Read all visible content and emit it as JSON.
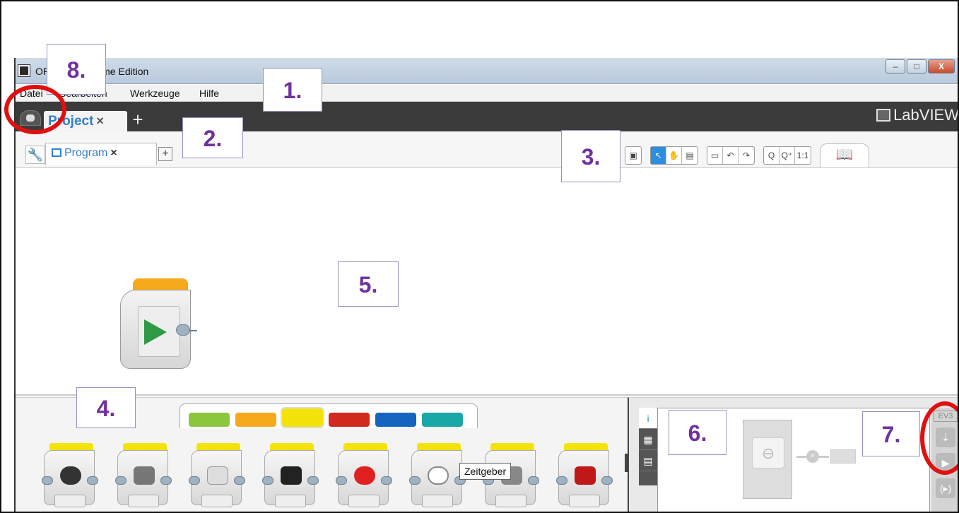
{
  "window": {
    "title": "ORMS EV3 Home Edition",
    "controls": {
      "minimize": "–",
      "maximize": "□",
      "close": "X"
    }
  },
  "menu": [
    "Datei",
    "Bearbeiten",
    "Werkzeuge",
    "Hilfe"
  ],
  "project_tab": {
    "label": "Project",
    "close": "×",
    "add": "+"
  },
  "brand": "LabVIEW",
  "program_tab": {
    "label": "Program",
    "close": "×",
    "add": "+"
  },
  "toolbar_groups": [
    [
      "▣"
    ],
    [
      "↖",
      "✋",
      "▤"
    ],
    [
      "▭",
      "↶",
      "↷"
    ],
    [
      "Q",
      "Q⁺",
      "1:1"
    ]
  ],
  "palette": {
    "tab_colors": [
      "#8cc63f",
      "#f7a91c",
      "#f4e30b",
      "#d2281e",
      "#1565c0",
      "#1aa7a7"
    ],
    "selected_index": 2,
    "tooltip": "Zeitgeber"
  },
  "hardware": {
    "tabs": [
      "i",
      "▦",
      "▤"
    ],
    "ev3_label": "EV3",
    "buttons": [
      "⇣",
      "▶",
      "(▸)"
    ]
  },
  "annotations": [
    "1.",
    "2.",
    "3.",
    "4.",
    "5.",
    "6.",
    "7.",
    "8."
  ]
}
